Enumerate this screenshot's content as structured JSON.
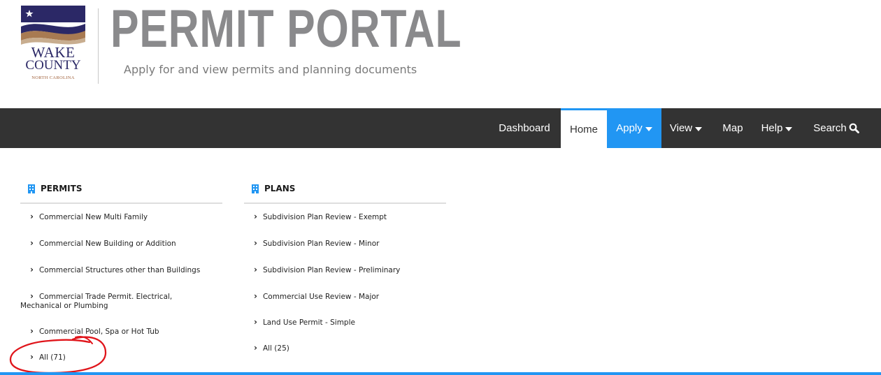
{
  "logo": {
    "wake": "WAKE",
    "county": "COUNTY",
    "state": "NORTH CAROLINA"
  },
  "header": {
    "title": "PERMIT PORTAL",
    "subtitle": "Apply for and view permits and planning documents"
  },
  "nav": {
    "dashboard": "Dashboard",
    "home": "Home",
    "apply": "Apply",
    "view": "View",
    "map": "Map",
    "help": "Help",
    "search": "Search"
  },
  "permits": {
    "heading": "PERMITS",
    "items": [
      "Commercial New Multi Family",
      "Commercial New Building or Addition",
      "Commercial Structures other than Buildings",
      "Commercial Trade Permit. Electrical,",
      "Mechanical or Plumbing",
      "Commercial Pool, Spa or Hot Tub",
      "All (71)"
    ]
  },
  "plans": {
    "heading": "PLANS",
    "items": [
      "Subdivision Plan Review - Exempt",
      "Subdivision Plan Review - Minor",
      "Subdivision Plan Review - Preliminary",
      "Commercial Use Review - Major",
      "Land Use Permit - Simple",
      "All (25)"
    ]
  },
  "colors": {
    "navbar": "#333333",
    "accent": "#2196f3",
    "annotation": "#e0151b"
  }
}
